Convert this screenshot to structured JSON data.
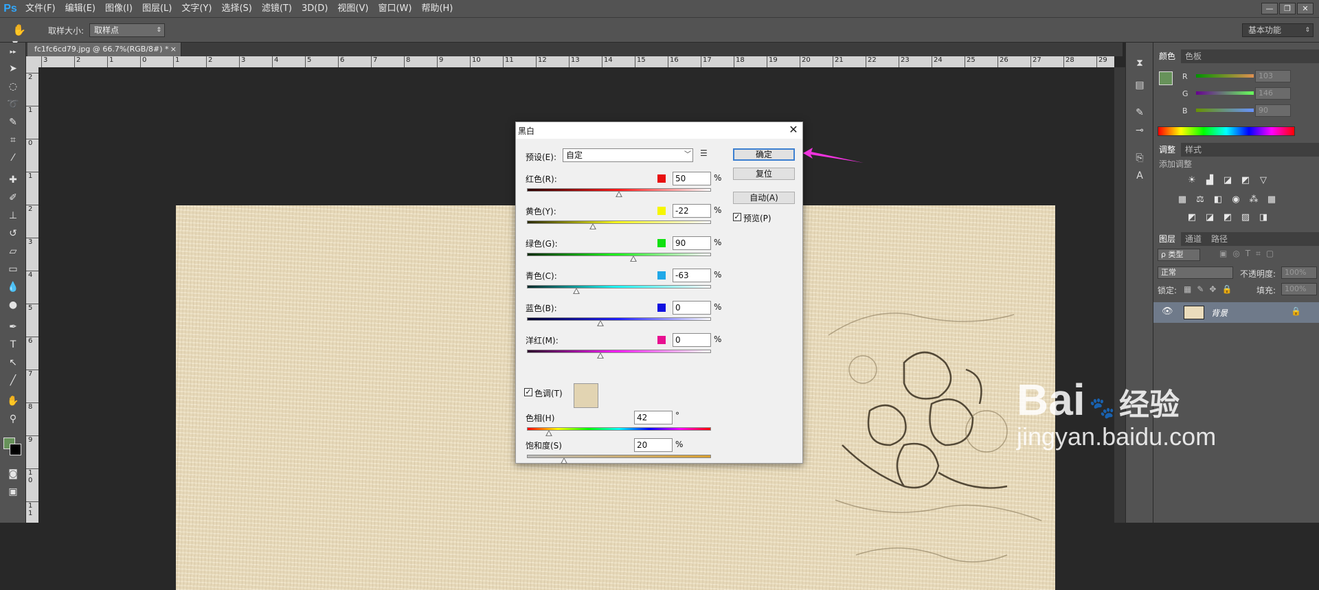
{
  "app": {
    "logo": "Ps"
  },
  "menu": [
    "文件(F)",
    "编辑(E)",
    "图像(I)",
    "图层(L)",
    "文字(Y)",
    "选择(S)",
    "滤镜(T)",
    "3D(D)",
    "视图(V)",
    "窗口(W)",
    "帮助(H)"
  ],
  "window_controls": {
    "minimize": "—",
    "restore": "❐",
    "close": "✕"
  },
  "options": {
    "sample_size_label": "取样大小:",
    "sample_size_value": "取样点",
    "workspace": "基本功能"
  },
  "document": {
    "tab_title": "fc1fc6cd79.jpg @ 66.7%(RGB/8#) *",
    "tab_close": "×"
  },
  "rulers": {
    "top": [
      "3",
      "2",
      "1",
      "0",
      "1",
      "2",
      "3",
      "4",
      "5",
      "6",
      "7",
      "8",
      "9",
      "10",
      "11",
      "12",
      "13",
      "14",
      "15",
      "16",
      "17",
      "18",
      "19",
      "20",
      "21",
      "22",
      "23",
      "24",
      "25",
      "26",
      "27",
      "28",
      "29"
    ],
    "left": [
      "2",
      "1",
      "0",
      "1",
      "2",
      "3",
      "4",
      "5",
      "6",
      "7",
      "8",
      "9",
      "1 0",
      "1 1"
    ]
  },
  "dialog": {
    "title": "黑白",
    "close": "✕",
    "preset_label": "预设(E):",
    "preset_value": "自定",
    "ok": "确定",
    "reset": "复位",
    "auto": "自动(A)",
    "preview_label": "预览(P)",
    "preview_checked": "✓",
    "channels": [
      {
        "label": "红色(R):",
        "value": "50",
        "unit": "%",
        "color": "#e81010",
        "track_from": "#2a0000",
        "track_to": "#ff1a1a",
        "slider": 0.5
      },
      {
        "label": "黄色(Y):",
        "value": "-22",
        "unit": "%",
        "color": "#f6f600",
        "track_from": "#2a2a00",
        "track_to": "#ffff20",
        "slider": 0.36
      },
      {
        "label": "绿色(G):",
        "value": "90",
        "unit": "%",
        "color": "#10e010",
        "track_from": "#002a00",
        "track_to": "#20ff20",
        "slider": 0.58
      },
      {
        "label": "青色(C):",
        "value": "-63",
        "unit": "%",
        "color": "#20a8e8",
        "track_from": "#002a2a",
        "track_to": "#20ffff",
        "slider": 0.27
      },
      {
        "label": "蓝色(B):",
        "value": "0",
        "unit": "%",
        "color": "#1010e0",
        "track_from": "#00002a",
        "track_to": "#2020ff",
        "slider": 0.4
      },
      {
        "label": "洋红(M):",
        "value": "0",
        "unit": "%",
        "color": "#e81090",
        "track_from": "#2a002a",
        "track_to": "#ff20ff",
        "slider": 0.4
      }
    ],
    "tint_label": "色调(T)",
    "tint_checked": "✓",
    "tint_color": "#e2d4b2",
    "hue_label": "色相(H)",
    "hue_value": "42",
    "hue_unit": "°",
    "hue_slider": 0.12,
    "saturation_label": "饱和度(S)",
    "saturation_value": "20",
    "saturation_unit": "%",
    "saturation_slider": 0.2
  },
  "panels": {
    "color_tabs": [
      "颜色",
      "色板"
    ],
    "color_rows": [
      {
        "letter": "R",
        "value": "103"
      },
      {
        "letter": "G",
        "value": "146"
      },
      {
        "letter": "B",
        "value": "90"
      }
    ],
    "foreground": "#67925a",
    "adjust_tabs": [
      "调整",
      "样式"
    ],
    "add_adjustment": "添加调整",
    "layer_tabs": [
      "图层",
      "通道",
      "路径"
    ],
    "kind_filter": "ρ 类型",
    "blend_mode": "正常",
    "opacity_label": "不透明度:",
    "opacity_value": "100%",
    "lock_label": "锁定:",
    "fill_label": "填充:",
    "fill_value": "100%",
    "layer_name": "背景"
  },
  "watermark": {
    "brand": "Bai",
    "brand_cn": "经验",
    "url": "jingyan.baidu.com"
  }
}
